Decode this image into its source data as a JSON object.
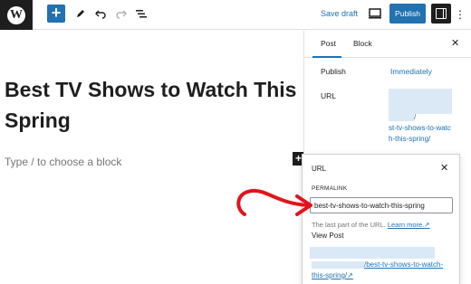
{
  "toolbar": {
    "logo_letter": "W",
    "add_label": "+",
    "save_draft": "Save draft",
    "publish": "Publish",
    "more": "⋮"
  },
  "editor": {
    "title": "Best TV Shows to Watch This Spring",
    "placeholder": "Type / to choose a block",
    "inserter": "+"
  },
  "sidebar": {
    "tabs": [
      "Post",
      "Block"
    ],
    "close": "✕",
    "publish_label": "Publish",
    "publish_value": "Immediately",
    "url_label": "URL",
    "url_value_line1": "/",
    "url_value_rest": "st-tv-shows-to-watch-this-spring/"
  },
  "popover": {
    "title": "URL",
    "close": "✕",
    "permalink_label": "PERMALINK",
    "permalink_value": "best-tv-shows-to-watch-this-spring",
    "help_text": "The last part of the URL.",
    "learn_more": "Learn more.↗",
    "view_post": "View Post",
    "link_text": "/best-tv-shows-to-watch-this-spring/↗"
  },
  "colors": {
    "accent": "#2271b1",
    "annotation": "#e3131b",
    "dark": "#1e1e1e"
  },
  "icons": [
    "wordpress-icon",
    "plus-icon",
    "pen-icon",
    "undo-icon",
    "redo-icon",
    "list-view-icon",
    "desktop-preview-icon",
    "settings-icon",
    "close-icon",
    "external-link-icon"
  ]
}
